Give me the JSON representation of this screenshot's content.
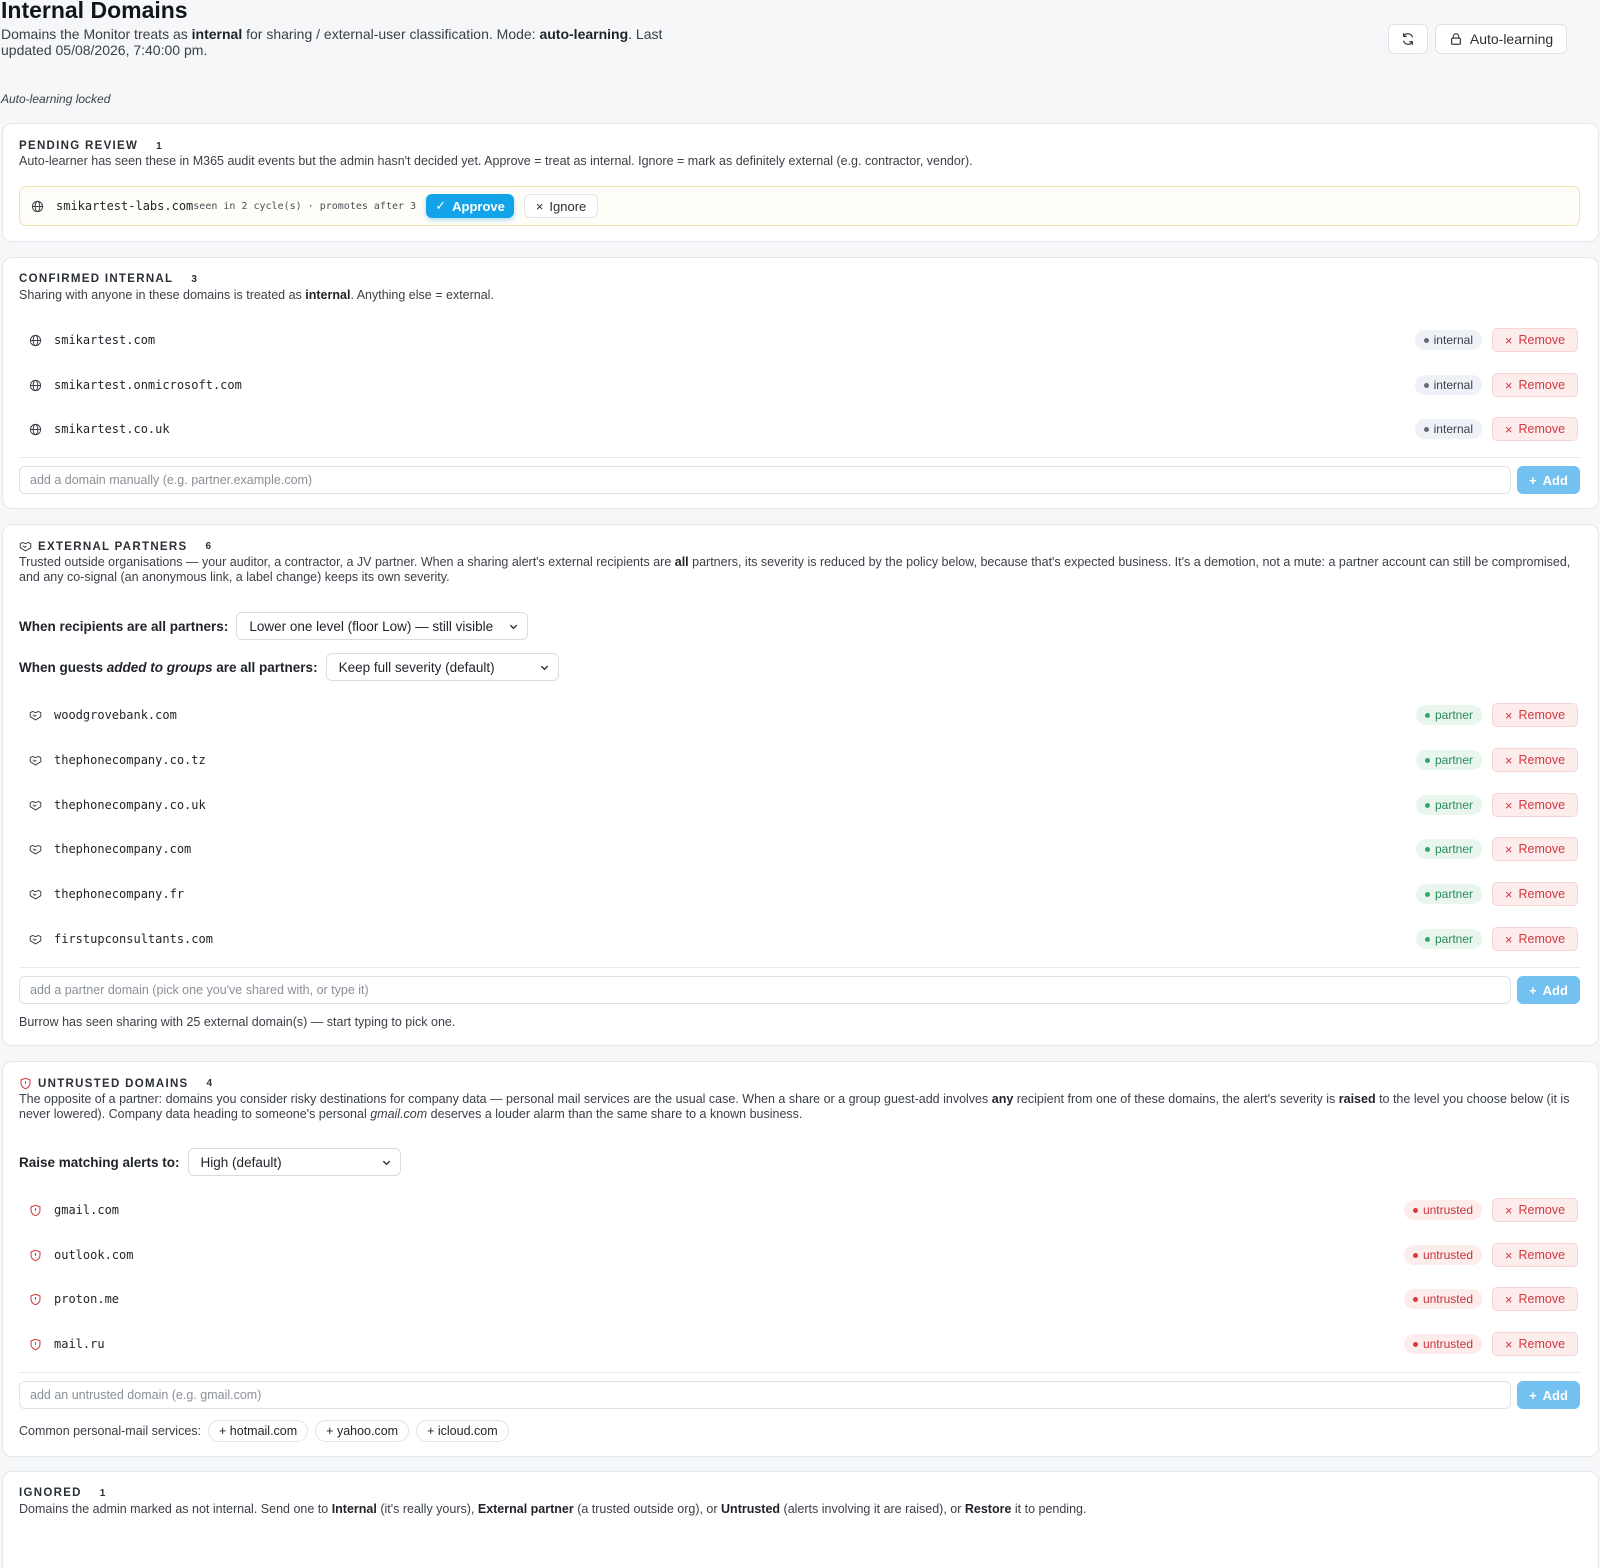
{
  "header": {
    "title": "Internal Domains",
    "subtitle_pre": "Domains the Monitor treats as ",
    "subtitle_bold1": "internal",
    "subtitle_mid": " for sharing / external-user classification. Mode: ",
    "subtitle_bold2": "auto-learning",
    "subtitle_post": ". Last updated 05/08/2026, 7:40:00 pm.",
    "auto_learning_label": "Auto-learning",
    "locked_note": "Auto-learning locked"
  },
  "pending": {
    "title": "PENDING REVIEW",
    "count": "1",
    "description": "Auto-learner has seen these in M365 audit events but the admin hasn't decided yet. Approve = treat as internal. Ignore = mark as definitely external (e.g. contractor, vendor).",
    "items": [
      {
        "domain": "smikartest-labs.com",
        "seen": "seen in 2 cycle(s) · promotes after 3",
        "approve": "Approve",
        "ignore": "Ignore"
      }
    ]
  },
  "confirmed": {
    "title": "CONFIRMED INTERNAL",
    "count": "3",
    "desc_pre": "Sharing with anyone in these domains is treated as ",
    "desc_bold": "internal",
    "desc_post": ". Anything else = external.",
    "badge": "internal",
    "remove": "Remove",
    "items": [
      "smikartest.com",
      "smikartest.onmicrosoft.com",
      "smikartest.co.uk"
    ],
    "placeholder": "add a domain manually (e.g. partner.example.com)",
    "add": "Add"
  },
  "partners": {
    "title": "EXTERNAL PARTNERS",
    "count": "6",
    "desc_pre": "Trusted outside organisations — your auditor, a contractor, a JV partner. When a sharing alert's external recipients are ",
    "desc_bold": "all",
    "desc_post": " partners, its severity is reduced by the policy below, because that's expected business. It's a demotion, not a mute: a partner account can still be compromised, and any co-signal (an anonymous link, a label change) keeps its own severity.",
    "policy1_label": "When recipients are all partners:",
    "policy1_value": "Lower one level (floor Low) — still visible",
    "policy2_pre": "When guests ",
    "policy2_em": "added to groups",
    "policy2_post": " are all partners:",
    "policy2_value": "Keep full severity (default)",
    "badge": "partner",
    "remove": "Remove",
    "items": [
      "woodgrovebank.com",
      "thephonecompany.co.tz",
      "thephonecompany.co.uk",
      "thephonecompany.com",
      "thephonecompany.fr",
      "firstupconsultants.com"
    ],
    "placeholder": "add a partner domain (pick one you've shared with, or type it)",
    "add": "Add",
    "hint": "Burrow has seen sharing with 25 external domain(s) — start typing to pick one."
  },
  "untrusted": {
    "title": "UNTRUSTED DOMAINS",
    "count": "4",
    "desc_1": "The opposite of a partner: domains you consider risky destinations for company data — personal mail services are the usual case. When a share or a group guest-add involves ",
    "desc_b1": "any",
    "desc_2": " recipient from one of these domains, the alert's severity is ",
    "desc_b2": "raised",
    "desc_3": " to the level you choose below (it is never lowered). Company data heading to someone's personal ",
    "desc_em": "gmail.com",
    "desc_4": " deserves a louder alarm than the same share to a known business.",
    "policy_label": "Raise matching alerts to:",
    "policy_value": "High (default)",
    "badge": "untrusted",
    "remove": "Remove",
    "items": [
      "gmail.com",
      "outlook.com",
      "proton.me",
      "mail.ru"
    ],
    "placeholder": "add an untrusted domain (e.g. gmail.com)",
    "add": "Add",
    "common_label": "Common personal-mail services:",
    "common": [
      "+ hotmail.com",
      "+ yahoo.com",
      "+ icloud.com"
    ]
  },
  "ignored": {
    "title": "IGNORED",
    "count": "1",
    "d1": "Domains the admin marked as not internal. Send one to ",
    "b1": "Internal",
    "d2": " (it's really yours), ",
    "b2": "External partner",
    "d3": " (a trusted outside org), or ",
    "b3": "Untrusted",
    "d4": " (alerts involving it are raised), or ",
    "b4": "Restore",
    "d5": " it to pending."
  }
}
